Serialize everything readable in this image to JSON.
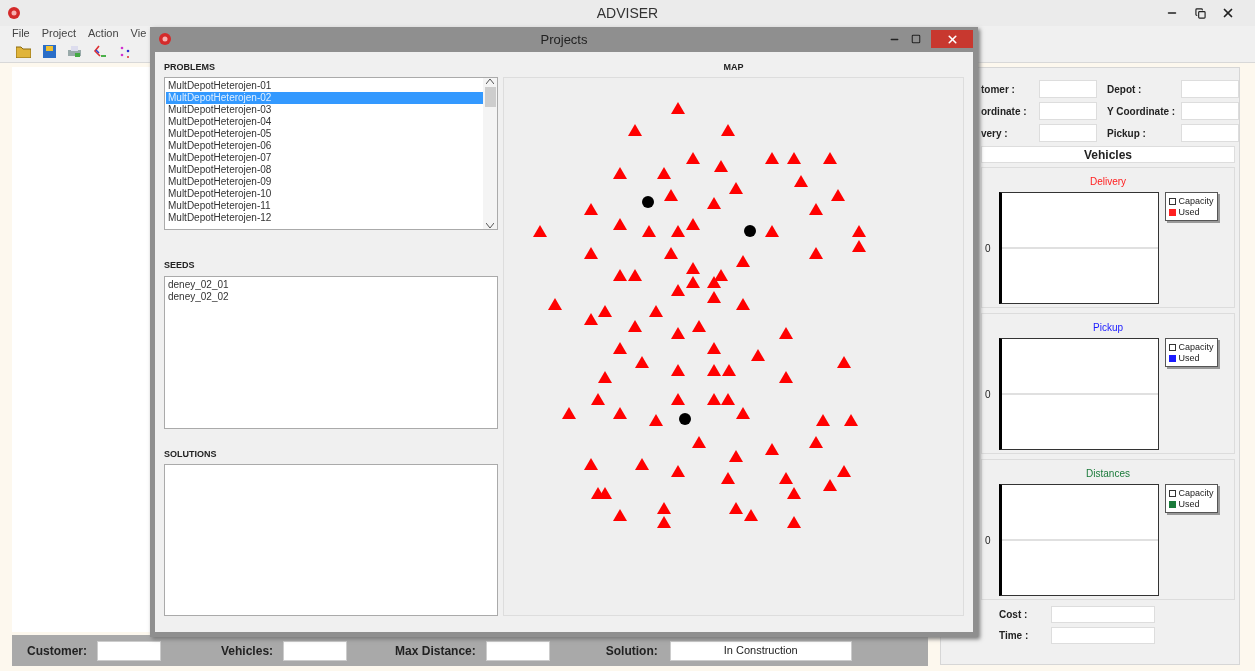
{
  "window": {
    "title": "ADVISER"
  },
  "menu": [
    "File",
    "Project",
    "Action",
    "Vie"
  ],
  "dialog": {
    "title": "Projects",
    "problems": {
      "label": "PROBLEMS",
      "items": [
        {
          "text": "MultDepotHeterojen-01",
          "selected": false
        },
        {
          "text": "MultDepotHeterojen-02",
          "selected": true
        },
        {
          "text": "MultDepotHeterojen-03",
          "selected": false
        },
        {
          "text": "MultDepotHeterojen-04",
          "selected": false
        },
        {
          "text": "MultDepotHeterojen-05",
          "selected": false
        },
        {
          "text": "MultDepotHeterojen-06",
          "selected": false
        },
        {
          "text": "MultDepotHeterojen-07",
          "selected": false
        },
        {
          "text": "MultDepotHeterojen-08",
          "selected": false
        },
        {
          "text": "MultDepotHeterojen-09",
          "selected": false
        },
        {
          "text": "MultDepotHeterojen-10",
          "selected": false
        },
        {
          "text": "MultDepotHeterojen-11",
          "selected": false
        },
        {
          "text": "MultDepotHeterojen-12",
          "selected": false
        }
      ]
    },
    "seeds": {
      "label": "SEEDS",
      "items": [
        "deney_02_01",
        "deney_02_02"
      ]
    },
    "solutions": {
      "label": "SOLUTIONS"
    },
    "map": {
      "label": "MAP"
    }
  },
  "details": {
    "fields": [
      {
        "label": "tomer :"
      },
      {
        "label": "Depot :"
      },
      {
        "label": "ordinate :"
      },
      {
        "label": "Y Coordinate :"
      },
      {
        "label": "very :"
      },
      {
        "label": "Pickup :"
      }
    ],
    "vehicles_header": "Vehicles",
    "charts": [
      {
        "title": "Delivery",
        "color": "#ff2020",
        "tick": "0",
        "legend": [
          "Capacity",
          "Used"
        ]
      },
      {
        "title": "Pickup",
        "color": "#1a1aff",
        "tick": "0",
        "legend": [
          "Capacity",
          "Used"
        ]
      },
      {
        "title": "Distances",
        "color": "#1a7a3a",
        "tick": "0",
        "legend": [
          "Capacity",
          "Used"
        ]
      }
    ],
    "totals": [
      {
        "label": "Cost :"
      },
      {
        "label": "Time :"
      }
    ]
  },
  "status_bar": [
    {
      "label": "Customer:"
    },
    {
      "label": "Vehicles:"
    },
    {
      "label": "Max Distance:"
    },
    {
      "label": "Solution:",
      "value": "In Construction"
    }
  ]
}
